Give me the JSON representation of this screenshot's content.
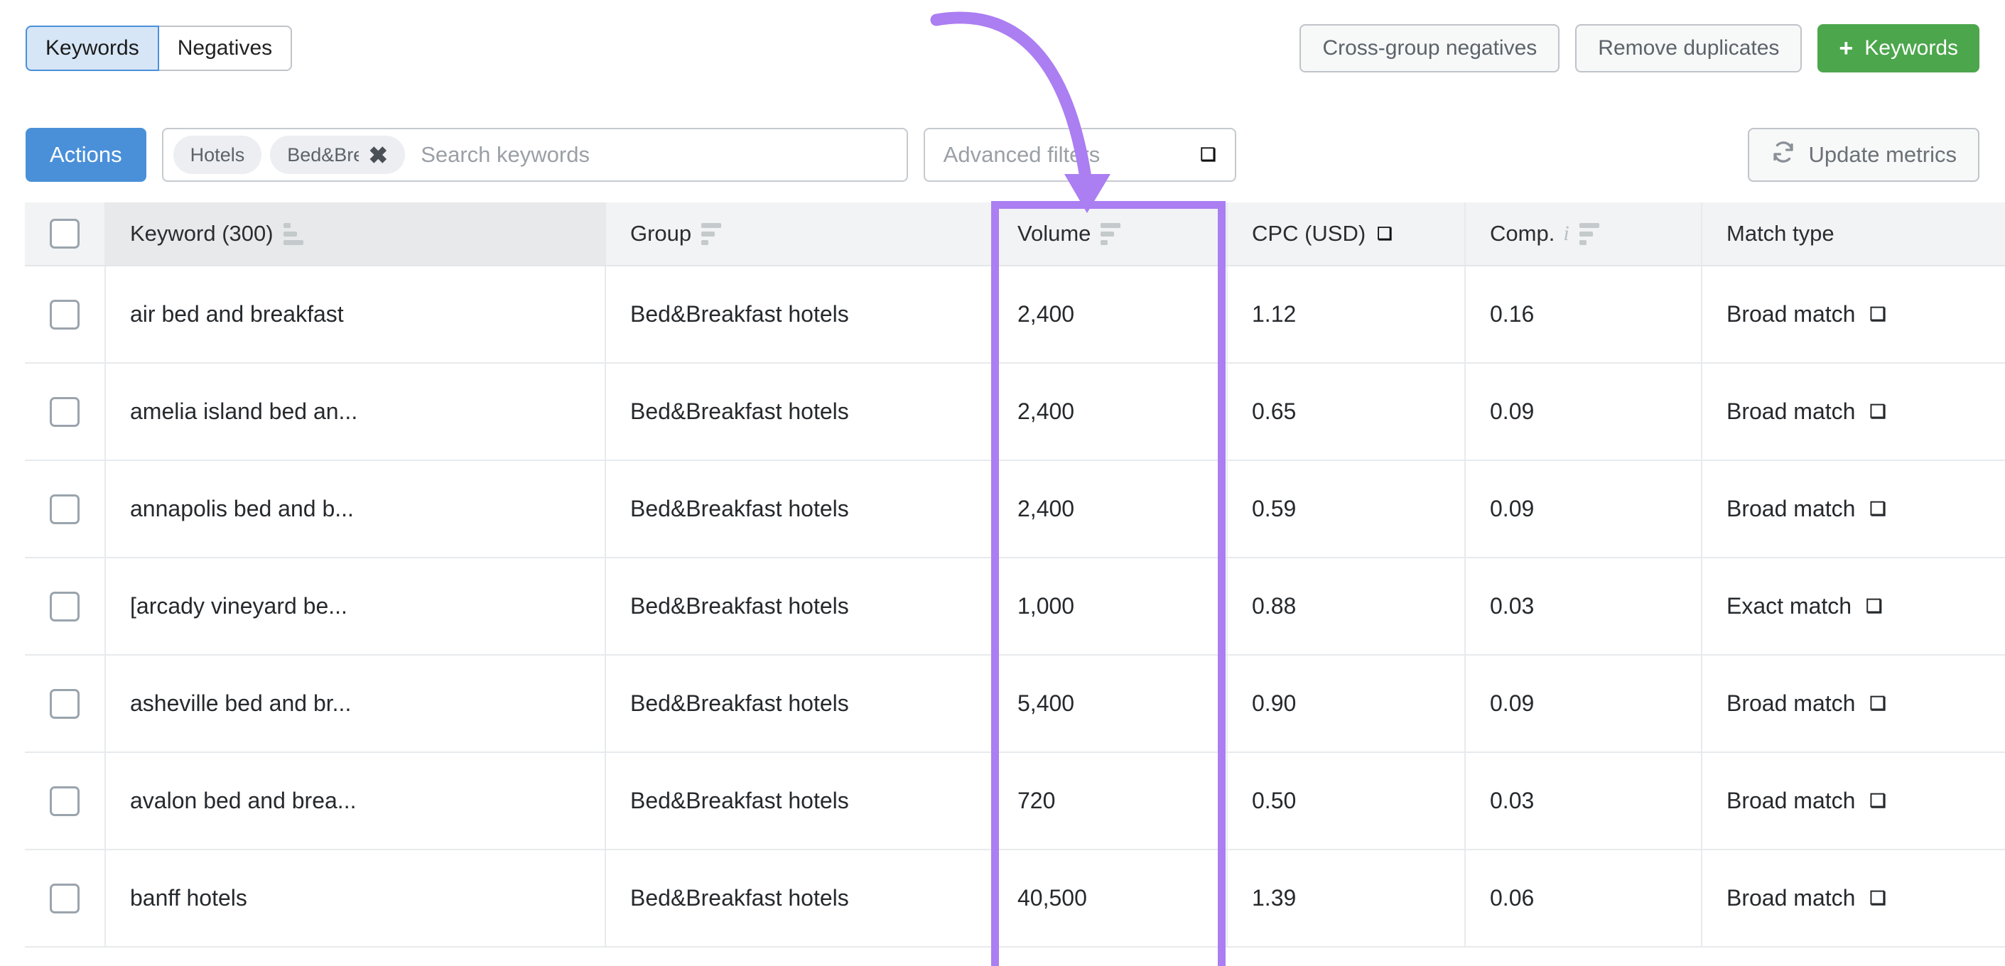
{
  "tabs": {
    "items": [
      {
        "label": "Keywords",
        "active": true
      },
      {
        "label": "Negatives",
        "active": false
      }
    ]
  },
  "header_actions": {
    "cross_group_negatives": "Cross-group negatives",
    "remove_duplicates": "Remove duplicates",
    "add_keywords": "Keywords",
    "add_keywords_icon": "plus-icon"
  },
  "toolbar": {
    "actions_label": "Actions",
    "search": {
      "placeholder": "Search keywords",
      "value": "",
      "chips": [
        {
          "label": "Hotels",
          "removable": false
        },
        {
          "label": "Bed&Brea",
          "removable": true,
          "remove_icon": "close-icon"
        }
      ]
    },
    "advanced_filters": {
      "label": "Advanced filters",
      "icon": "chevron-down-icon"
    },
    "update_metrics": {
      "label": "Update metrics",
      "icon": "refresh-icon"
    }
  },
  "table": {
    "select_all_checkbox": "unchecked",
    "columns": [
      {
        "label": "Keyword (300)",
        "sort_icon": "sort-ascending-icon",
        "info_icon": null,
        "dropdown_icon": null
      },
      {
        "label": "Group",
        "sort_icon": "sort-descending-icon",
        "info_icon": null,
        "dropdown_icon": null
      },
      {
        "label": "Volume",
        "sort_icon": "sort-descending-icon",
        "info_icon": null,
        "dropdown_icon": null
      },
      {
        "label": "CPC (USD)",
        "sort_icon": null,
        "info_icon": null,
        "dropdown_icon": "chevron-down-icon"
      },
      {
        "label": "Comp.",
        "sort_icon": "sort-descending-icon",
        "info_icon": "info-icon",
        "dropdown_icon": null
      },
      {
        "label": "Match type",
        "sort_icon": null,
        "info_icon": null,
        "dropdown_icon": null
      }
    ],
    "rows": [
      {
        "checkbox": "unchecked",
        "keyword": "air bed and breakfast",
        "group": "Bed&Breakfast hotels",
        "volume": "2,400",
        "cpc": "1.12",
        "comp": "0.16",
        "match_type": "Broad match",
        "match_icon": "chevron-down-icon"
      },
      {
        "checkbox": "unchecked",
        "keyword": "amelia island bed an...",
        "group": "Bed&Breakfast hotels",
        "volume": "2,400",
        "cpc": "0.65",
        "comp": "0.09",
        "match_type": "Broad match",
        "match_icon": "chevron-down-icon"
      },
      {
        "checkbox": "unchecked",
        "keyword": "annapolis bed and b...",
        "group": "Bed&Breakfast hotels",
        "volume": "2,400",
        "cpc": "0.59",
        "comp": "0.09",
        "match_type": "Broad match",
        "match_icon": "chevron-down-icon"
      },
      {
        "checkbox": "unchecked",
        "keyword": "[arcady vineyard be...",
        "group": "Bed&Breakfast hotels",
        "volume": "1,000",
        "cpc": "0.88",
        "comp": "0.03",
        "match_type": "Exact match",
        "match_icon": "chevron-down-icon"
      },
      {
        "checkbox": "unchecked",
        "keyword": "asheville bed and br...",
        "group": "Bed&Breakfast hotels",
        "volume": "5,400",
        "cpc": "0.90",
        "comp": "0.09",
        "match_type": "Broad match",
        "match_icon": "chevron-down-icon"
      },
      {
        "checkbox": "unchecked",
        "keyword": "avalon bed and brea...",
        "group": "Bed&Breakfast hotels",
        "volume": "720",
        "cpc": "0.50",
        "comp": "0.03",
        "match_type": "Broad match",
        "match_icon": "chevron-down-icon"
      },
      {
        "checkbox": "unchecked",
        "keyword": "banff hotels",
        "group": "Bed&Breakfast hotels",
        "volume": "40,500",
        "cpc": "1.39",
        "comp": "0.06",
        "match_type": "Broad match",
        "match_icon": "chevron-down-icon"
      }
    ]
  },
  "annotation": {
    "color": "#ab7ef2",
    "arrow": "curved-arrow-pointing-down-to-volume-column",
    "highlight_target": "Volume"
  },
  "colors": {
    "accent_blue": "#4a90d9",
    "tab_active_bg": "#d6e6f7",
    "green": "#4ca64c",
    "annotation_purple": "#ab7ef2",
    "header_bg": "#f1f3f4"
  }
}
